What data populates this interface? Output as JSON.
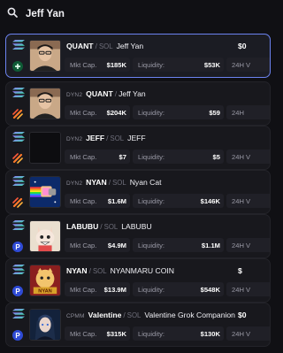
{
  "search": {
    "query": "Jeff Yan"
  },
  "results": [
    {
      "tag": "",
      "ticker": "QUANT",
      "chain": "SOL",
      "name": "Jeff Yan",
      "mkt_label": "Mkt Cap.",
      "mkt": "$185K",
      "liq_label": "Liquidity:",
      "liq": "$53K",
      "vol_label": "24H V",
      "price": "$0",
      "platform": "pump-icon",
      "thumb": "portrait-icon"
    },
    {
      "tag": "DYN2",
      "ticker": "QUANT",
      "chain": "",
      "name": "Jeff Yan",
      "mkt_label": "Mkt Cap.",
      "mkt": "$204K",
      "liq_label": "Liquidity:",
      "liq": "$59",
      "vol_label": "24H",
      "price": "",
      "platform": "dyn-icon",
      "thumb": "portrait-icon"
    },
    {
      "tag": "DYN2",
      "ticker": "JEFF",
      "chain": "SOL",
      "name": "JEFF",
      "mkt_label": "Mkt Cap.",
      "mkt": "$7",
      "liq_label": "Liquidity:",
      "liq": "$5",
      "vol_label": "24H V",
      "price": "",
      "platform": "dyn-icon",
      "thumb": "blank-icon"
    },
    {
      "tag": "DYN2",
      "ticker": "NYAN",
      "chain": "SOL",
      "name": "Nyan Cat",
      "mkt_label": "Mkt Cap.",
      "mkt": "$1.6M",
      "liq_label": "Liquidity:",
      "liq": "$146K",
      "vol_label": "24H V",
      "price": "",
      "platform": "dyn-icon",
      "thumb": "nyan-cat-icon"
    },
    {
      "tag": "",
      "ticker": "LABUBU",
      "chain": "SOL",
      "name": "LABUBU",
      "mkt_label": "Mkt Cap.",
      "mkt": "$4.9M",
      "liq_label": "Liquidity:",
      "liq": "$1.1M",
      "vol_label": "24H V",
      "price": "",
      "platform": "p-icon",
      "thumb": "labubu-icon"
    },
    {
      "tag": "",
      "ticker": "NYAN",
      "chain": "SOL",
      "name": "NYANMARU COIN",
      "mkt_label": "Mkt Cap.",
      "mkt": "$13.9M",
      "liq_label": "Liquidity:",
      "liq": "$548K",
      "vol_label": "24H V",
      "price": "$",
      "platform": "p-icon",
      "thumb": "nyanmaru-icon"
    },
    {
      "tag": "CPMM",
      "ticker": "Valentine",
      "chain": "SOL",
      "name": "Valentine Grok Companion",
      "mkt_label": "Mkt Cap.",
      "mkt": "$315K",
      "liq_label": "Liquidity:",
      "liq": "$130K",
      "vol_label": "24H V",
      "price": "$0",
      "platform": "p-icon",
      "thumb": "anime-portrait-icon"
    }
  ],
  "colors": {
    "accent": "#6c83f0",
    "background": "#101014",
    "card": "#18181d"
  }
}
